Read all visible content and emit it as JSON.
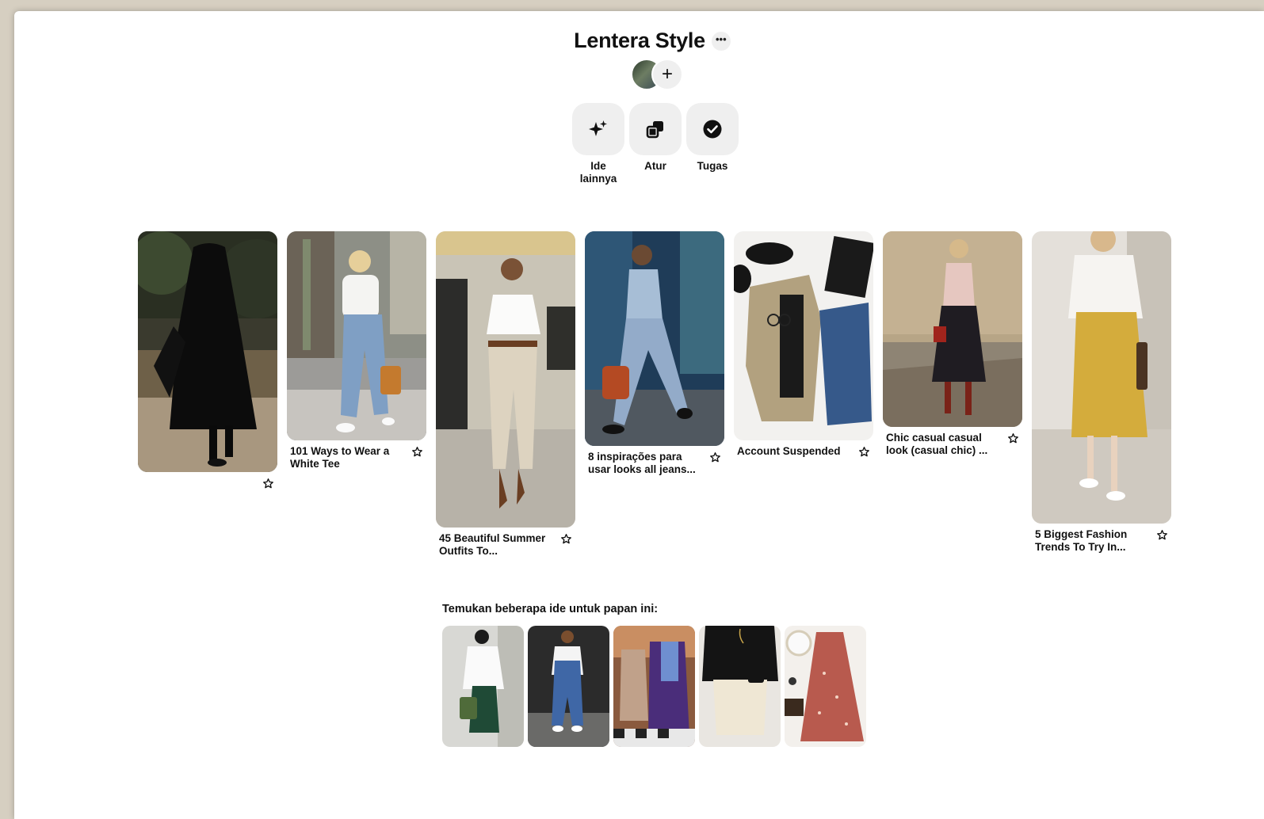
{
  "board": {
    "title": "Lentera Style",
    "more_icon": "ellipsis-icon",
    "add_collaborator_icon": "plus-icon"
  },
  "actions": [
    {
      "label": "Ide lainnya",
      "icon": "sparkle-icon"
    },
    {
      "label": "Atur",
      "icon": "organize-icon"
    },
    {
      "label": "Tugas",
      "icon": "check-circle-icon"
    }
  ],
  "pins": [
    {
      "caption": ""
    },
    {
      "caption": "101 Ways to Wear a White Tee"
    },
    {
      "caption": "45 Beautiful Summer Outfits To..."
    },
    {
      "caption": "8 inspirações para usar looks all jeans..."
    },
    {
      "caption": "Account Suspended"
    },
    {
      "caption": "Chic casual casual look (casual chic) ..."
    },
    {
      "caption": "5 Biggest Fashion Trends To Try In..."
    }
  ],
  "suggestions": {
    "title": "Temukan beberapa ide untuk papan ini:"
  }
}
